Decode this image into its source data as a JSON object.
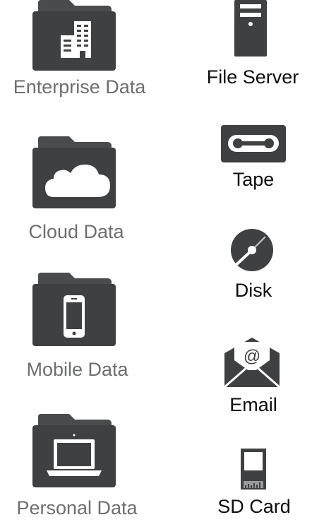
{
  "colors": {
    "icon_dark": "#3f4041",
    "icon_tab": "#4a4b4c",
    "left_label": "#6d6e70",
    "right_label": "#0d0d0d",
    "background": "#ffffff"
  },
  "left_items": [
    {
      "label": "Enterprise Data",
      "icon": "building-folder-icon"
    },
    {
      "label": "Cloud Data",
      "icon": "cloud-folder-icon"
    },
    {
      "label": "Mobile Data",
      "icon": "mobile-folder-icon"
    },
    {
      "label": "Personal Data",
      "icon": "laptop-folder-icon"
    }
  ],
  "right_items": [
    {
      "label": "File Server",
      "icon": "server-icon"
    },
    {
      "label": "Tape",
      "icon": "tape-icon"
    },
    {
      "label": "Disk",
      "icon": "disk-icon"
    },
    {
      "label": "Email",
      "icon": "email-icon"
    },
    {
      "label": "SD Card",
      "icon": "sd-card-icon"
    }
  ]
}
